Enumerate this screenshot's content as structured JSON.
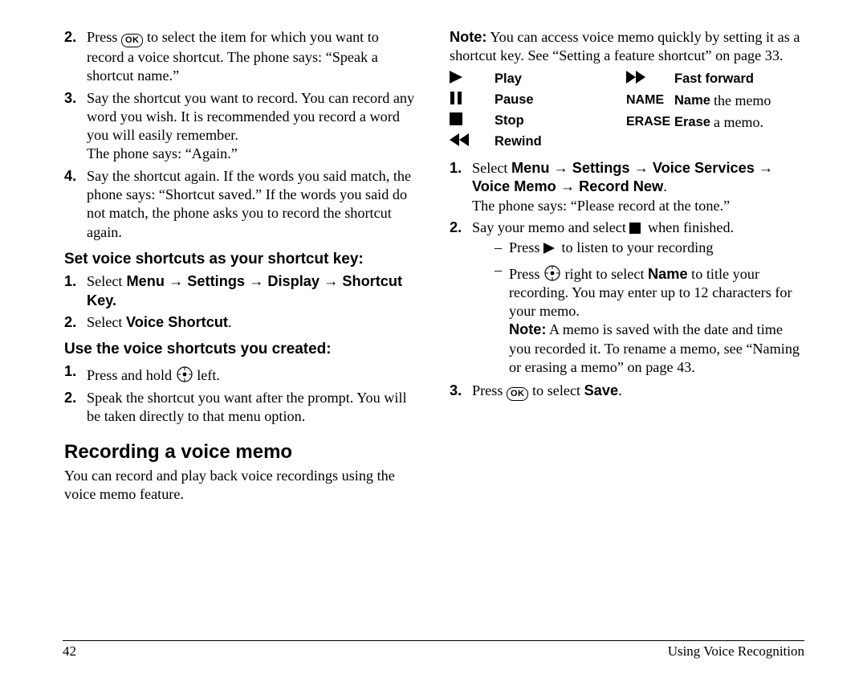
{
  "left": {
    "step2": "Press",
    "step2_after": "to select the item for which you want to record a voice shortcut. The phone says: “Speak a shortcut name.”",
    "step3": "Say the shortcut you want to record. You can record any word you wish. It is recommended you record a word you will easily remember.",
    "step3_line2": "The phone says: “Again.”",
    "step4": "Say the shortcut again. If the words you said match, the phone says: “Shortcut saved.” If the words you said do not match, the phone asks you to record the shortcut again.",
    "sub1_heading": "Set voice shortcuts as your shortcut key:",
    "sub1_step1_pre": "Select",
    "sub1_step1_path": "Menu → Settings → Display → Shortcut Key.",
    "sub1_step2_pre": "Select",
    "sub1_step2_strong": "Voice Shortcut",
    "sub2_heading": "Use the voice shortcuts you created:",
    "sub2_step1_pre": "Press and hold",
    "sub2_step1_post": "left.",
    "sub2_step2": "Speak the shortcut you want after the prompt. You will be taken directly to that menu option.",
    "h1": "Recording a voice memo",
    "h1_body": "You can record and play back voice recordings using the voice memo feature."
  },
  "right": {
    "note_strong": "Note:",
    "note_body": "You can access voice memo quickly by setting it as a shortcut key. See “Setting a feature shortcut” on page 33.",
    "icons": {
      "play": "Play",
      "pause": "Pause",
      "stop": "Stop",
      "rewind": "Rewind",
      "ff": "Fast forward",
      "name_key": "NAME",
      "name_lbl": "Name",
      "name_extra": "the memo",
      "erase_key": "ERASE",
      "erase_lbl": "Erase",
      "erase_extra": "a memo."
    },
    "step1_pre": "Select",
    "step1_path": "Menu → Settings → Voice Services → Voice Memo → Record New",
    "step1_body": "The phone says: “Please record at the tone.”",
    "step2_pre": "Say your memo and select",
    "step2_post": "when finished.",
    "dash1_pre": "Press",
    "dash1_post": "to listen to your recording",
    "dash2_pre": "Press",
    "dash2_mid": "right to select",
    "dash2_strong": "Name",
    "dash2_post": "to title your recording. You may enter up to 12 characters for your memo.",
    "dash2_note_strong": "Note:",
    "dash2_note": "A memo is saved with the date and time you recorded it. To rename a memo, see “Naming or erasing a memo” on page 43.",
    "step3_pre": "Press",
    "step3_mid": "to select",
    "step3_strong": "Save"
  },
  "footer": {
    "page": "42",
    "section": "Using Voice Recognition"
  }
}
